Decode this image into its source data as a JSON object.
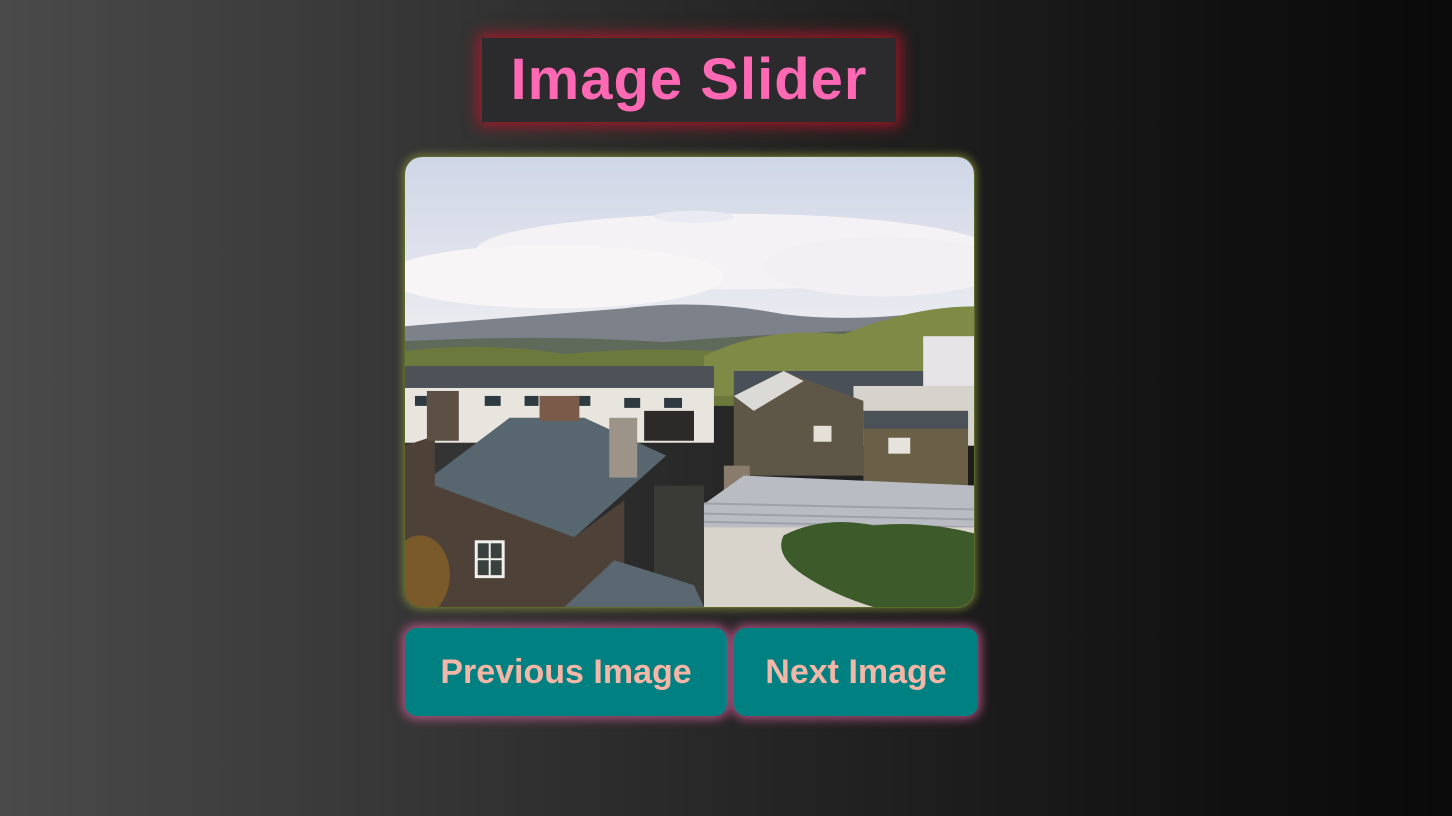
{
  "page": {
    "title": "Image Slider"
  },
  "slider": {
    "image": {
      "icon": "village-rooftops-photo"
    }
  },
  "controls": {
    "previous_label": "Previous Image",
    "next_label": "Next Image"
  },
  "colors": {
    "title_text": "#ff69b4",
    "title_glow": "#c81428",
    "button_bg": "#008080",
    "button_text": "#f4b6a6",
    "button_glow": "#ff69b4"
  }
}
